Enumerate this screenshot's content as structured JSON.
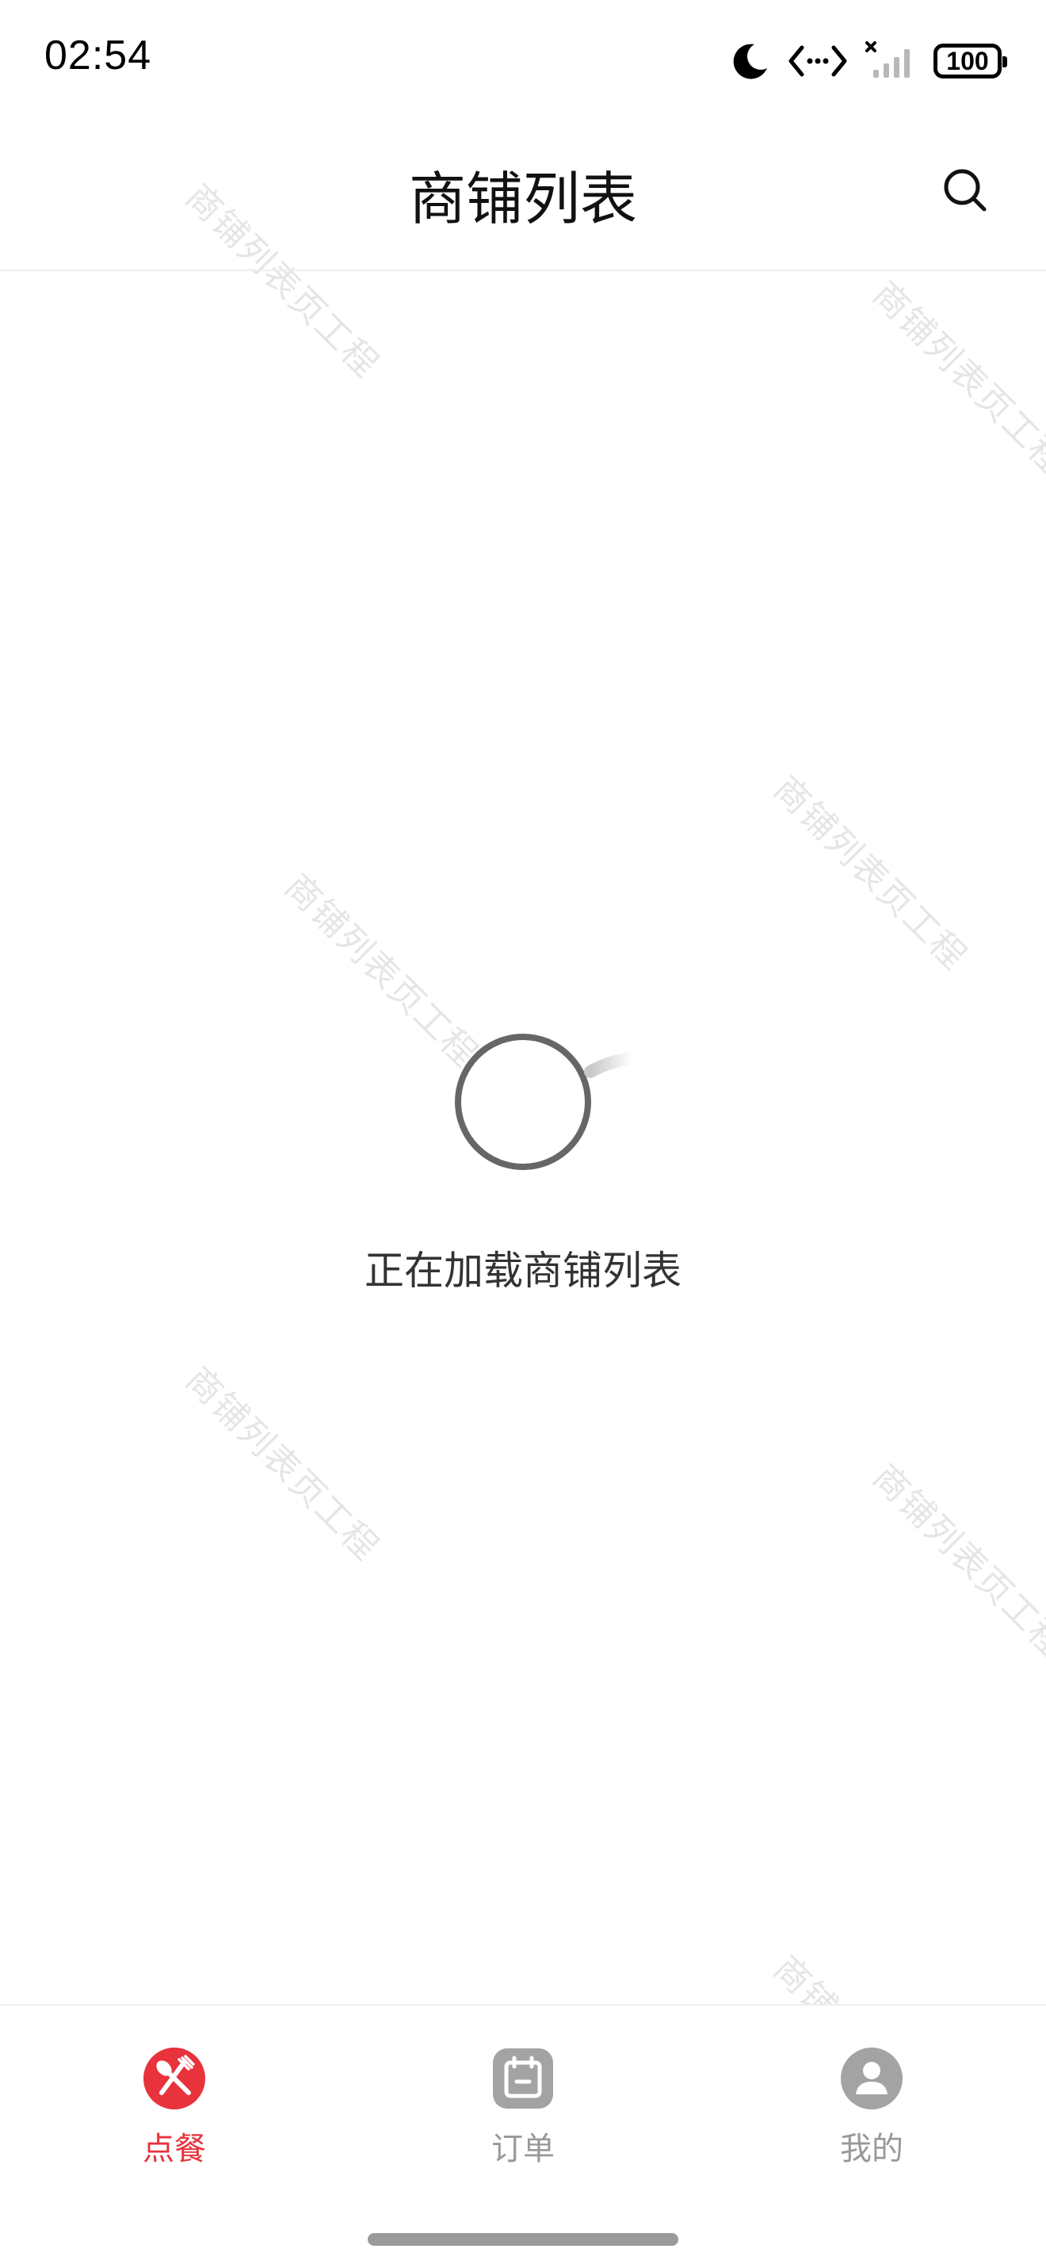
{
  "status_bar": {
    "time": "02:54",
    "battery": "100",
    "icons": [
      "moon-icon",
      "data-transfer-icon",
      "signal-no-service-icon",
      "battery-icon"
    ]
  },
  "header": {
    "title": "商铺列表",
    "search_icon": "search-icon"
  },
  "watermark_text": "商铺列表页工程",
  "loading": {
    "text": "正在加载商铺列表"
  },
  "tab_bar": {
    "accent_color": "#e8323c",
    "inactive_color": "#9e9e9e",
    "tabs": [
      {
        "label": "点餐",
        "icon": "utensils-icon",
        "active": true
      },
      {
        "label": "订单",
        "icon": "calendar-icon",
        "active": false
      },
      {
        "label": "我的",
        "icon": "user-icon",
        "active": false
      }
    ]
  }
}
